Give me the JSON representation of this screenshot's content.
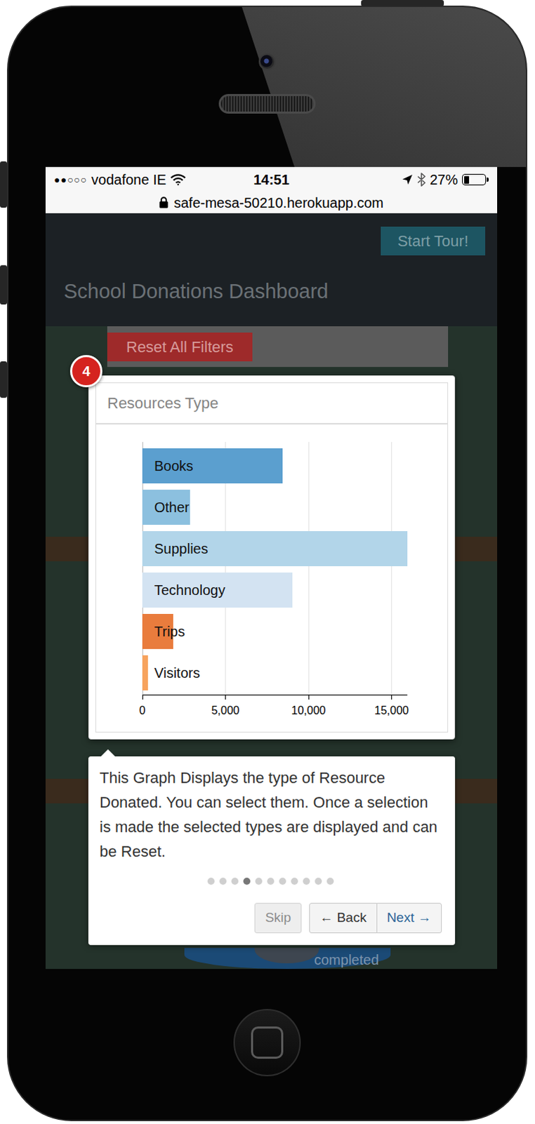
{
  "status_bar": {
    "signal": "●●○○○",
    "carrier": "vodafone IE",
    "time": "14:51",
    "battery": "27%",
    "battery_level": 0.27
  },
  "address_bar": {
    "url": "safe-mesa-50210.herokuapp.com"
  },
  "header": {
    "tour_button": "Start Tour!",
    "title": "School Donations Dashboard"
  },
  "filters": {
    "reset_button": "Reset All Filters"
  },
  "tour_step": {
    "badge": "4"
  },
  "chart": {
    "title": "Resources Type",
    "bars": [
      {
        "label": "Books",
        "value": 8450,
        "color": "#5b9fcf"
      },
      {
        "label": "Other",
        "value": 2890,
        "color": "#8cc0df"
      },
      {
        "label": "Supplies",
        "value": 15950,
        "color": "#b2d5e9"
      },
      {
        "label": "Technology",
        "value": 9050,
        "color": "#d3e3f2"
      },
      {
        "label": "Trips",
        "value": 1850,
        "color": "#e97c3d"
      },
      {
        "label": "Visitors",
        "value": 340,
        "color": "#f7a35e"
      }
    ],
    "ticks": [
      {
        "value": 0,
        "label": "0"
      },
      {
        "value": 5000,
        "label": "5,000"
      },
      {
        "value": 10000,
        "label": "10,000"
      },
      {
        "value": 15000,
        "label": "15,000"
      }
    ]
  },
  "popover": {
    "text": "This Graph Displays the type of Resource Donated. You can select them. Once a selection is made the selected types are displayed and can be Reset.",
    "steps": [
      {
        "selected": false
      },
      {
        "selected": false
      },
      {
        "selected": false
      },
      {
        "selected": true
      },
      {
        "selected": false
      },
      {
        "selected": false
      },
      {
        "selected": false
      },
      {
        "selected": false
      },
      {
        "selected": false
      },
      {
        "selected": false
      },
      {
        "selected": false
      }
    ],
    "buttons": [
      {
        "label": "Skip",
        "disabled": true,
        "kind": "standalone"
      },
      {
        "label": "← Back",
        "disabled": false,
        "kind": "grouped"
      },
      {
        "label": "Next →",
        "disabled": false,
        "kind": "primary"
      }
    ]
  },
  "background": {
    "progress_label": "completed"
  }
}
